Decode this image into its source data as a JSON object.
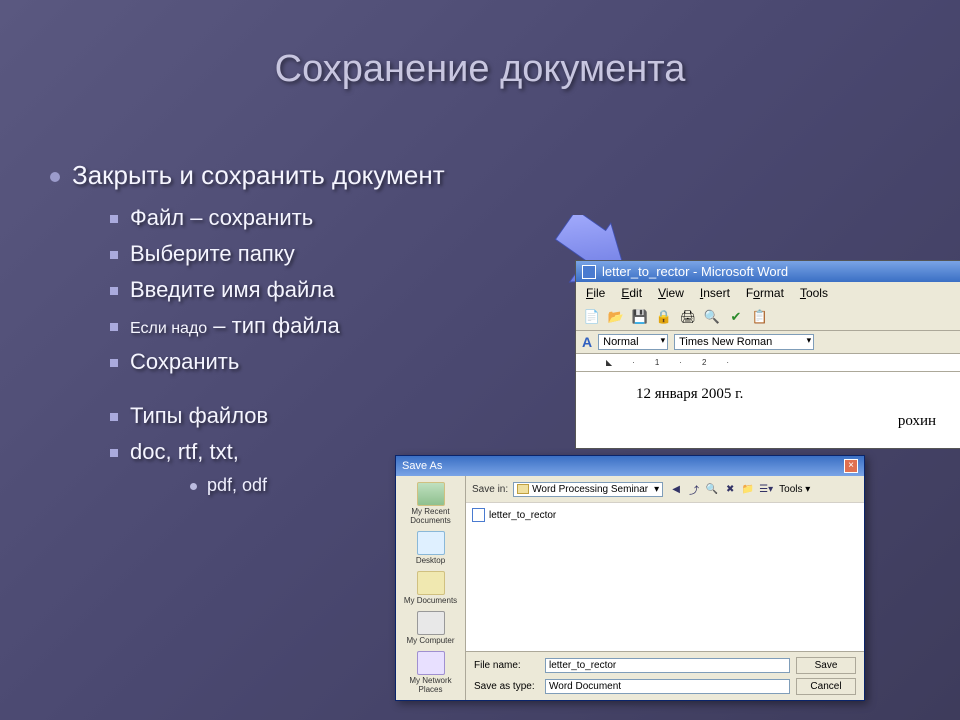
{
  "slide": {
    "title": "Сохранение документа",
    "bullet_main": "Закрыть и сохранить документ",
    "items": [
      "Файл – сохранить",
      "Выберите папку",
      "Введите имя файла",
      "Если надо – тип файла",
      "Сохранить"
    ],
    "item_prefix_small": "Если надо",
    "item_suffix_large": " – тип файла",
    "types_header": "Типы файлов",
    "types_line": "doc, rtf, txt,",
    "types_sub": "pdf, odf"
  },
  "word": {
    "title": "letter_to_rector - Microsoft Word",
    "menu": [
      "File",
      "Edit",
      "View",
      "Insert",
      "Format",
      "Tools"
    ],
    "style_label": "Normal",
    "font_label": "Times New Roman",
    "aa_label": "A",
    "doc_date": "12 января 2005 г.",
    "doc_name_fragment": "рохин"
  },
  "save_dialog": {
    "title": "Save As",
    "save_in_label": "Save in:",
    "save_in_value": "Word Processing Seminar",
    "tools_label": "Tools",
    "sidebar": [
      "My Recent Documents",
      "Desktop",
      "My Documents",
      "My Computer",
      "My Network Places"
    ],
    "file_item": "letter_to_rector",
    "filename_label": "File name:",
    "filename_value": "letter_to_rector",
    "savetype_label": "Save as type:",
    "savetype_value": "Word Document",
    "save_btn": "Save",
    "cancel_btn": "Cancel"
  }
}
